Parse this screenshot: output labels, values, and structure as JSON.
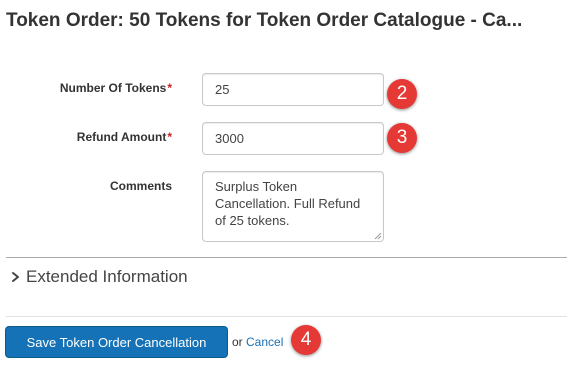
{
  "page": {
    "title": "Token Order: 50 Tokens for Token Order Catalogue - Ca..."
  },
  "form": {
    "number_of_tokens": {
      "label": "Number Of Tokens",
      "required_mark": "*",
      "value": "25"
    },
    "refund_amount": {
      "label": "Refund Amount",
      "required_mark": "*",
      "value": "3000"
    },
    "comments": {
      "label": "Comments",
      "value": "Surplus Token Cancellation. Full Refund of 25 tokens."
    }
  },
  "extended": {
    "label": "Extended Information",
    "icon": "chevron-right-icon"
  },
  "actions": {
    "save_label": "Save Token Order Cancellation",
    "or_text": "or",
    "cancel_label": "Cancel"
  },
  "callouts": {
    "badge_2": "2",
    "badge_3": "3",
    "badge_4": "4"
  },
  "colors": {
    "primary_button": "#1572b6",
    "callout_badge": "#e53935",
    "required_mark": "#cc2222",
    "link": "#1a6fb3"
  }
}
